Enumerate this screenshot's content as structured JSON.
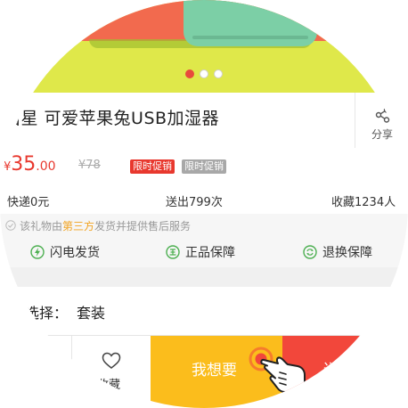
{
  "product": {
    "title": "由星 可爱苹果兔USB加湿器",
    "share_label": "分享"
  },
  "carousel": {
    "count": 3,
    "active_index": 0
  },
  "price": {
    "currency": "¥",
    "integer": "35",
    "decimal": ".00",
    "original": "¥78",
    "tags": [
      "限时促销",
      "限时促销"
    ]
  },
  "stats": {
    "shipping": "快递0元",
    "sold": "送出799次",
    "favorites": "收藏1234人"
  },
  "service": {
    "prefix": "该礼物由",
    "highlight": "第三方",
    "suffix": "发货并提供售后服务"
  },
  "guarantees": [
    {
      "label": "闪电发货",
      "icon": "lightning-icon"
    },
    {
      "label": "正品保障",
      "icon": "genuine-icon"
    },
    {
      "label": "退换保障",
      "icon": "return-icon"
    }
  ],
  "spec": {
    "label": "选择：",
    "value": "套装"
  },
  "actions": {
    "favorite_label": "收藏",
    "want_label": "我想要",
    "buy_label": "送"
  },
  "colors": {
    "accent_red": "#e8382e",
    "accent_yellow": "#fbbd1c",
    "highlight_orange": "#f1a321",
    "icon_green": "#4caf50"
  }
}
